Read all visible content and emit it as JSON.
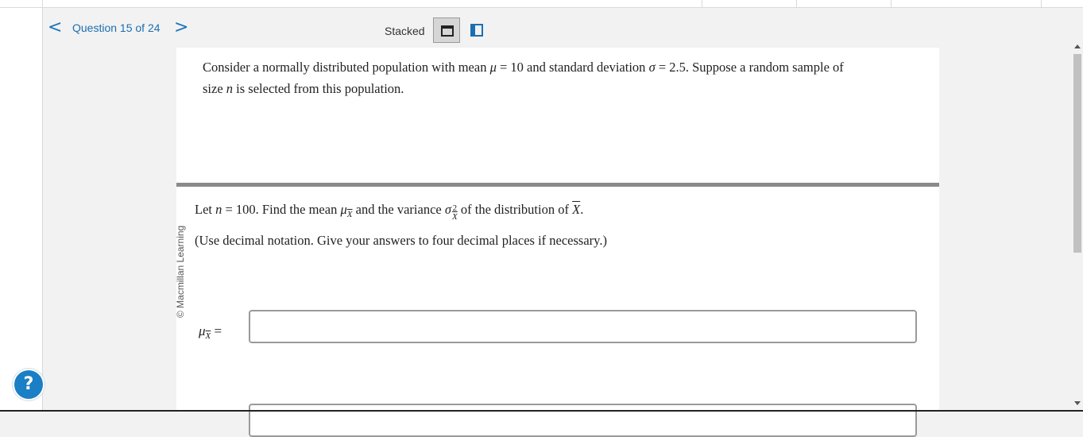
{
  "nav": {
    "prev_glyph": "<",
    "next_glyph": ">",
    "title": "Question 15 of 24"
  },
  "view": {
    "label": "Stacked",
    "icons": [
      "stacked-view-icon",
      "split-view-icon"
    ]
  },
  "problem": {
    "line1_a": "Consider a normally distributed population with mean ",
    "mu": "μ",
    "eq1": " = 10 and standard deviation ",
    "sigma": "σ",
    "eq2": " = 2.5. Suppose a random sample of",
    "line2_a": "size ",
    "n": "n",
    "line2_b": " is selected from this population."
  },
  "copyright": "© Macmillan Learning",
  "part": {
    "a": "Let ",
    "n": "n",
    "b": " = 100. Find the mean ",
    "mu": "μ",
    "xsub": "X",
    "c": " and the variance ",
    "sigma": "σ",
    "sup2": "2",
    "d": " of the distribution of ",
    "xbar": "X",
    "e": "."
  },
  "instruction": "(Use decimal notation. Give your answers to four decimal places if necessary.)",
  "answer": {
    "mu": "μ",
    "xsub": "X",
    "eq": " =",
    "mean_value": ""
  },
  "help_glyph": "?",
  "colors": {
    "accent": "#1b75bb",
    "help_bg": "#1a7fc4",
    "divider": "#8a8a8a"
  }
}
